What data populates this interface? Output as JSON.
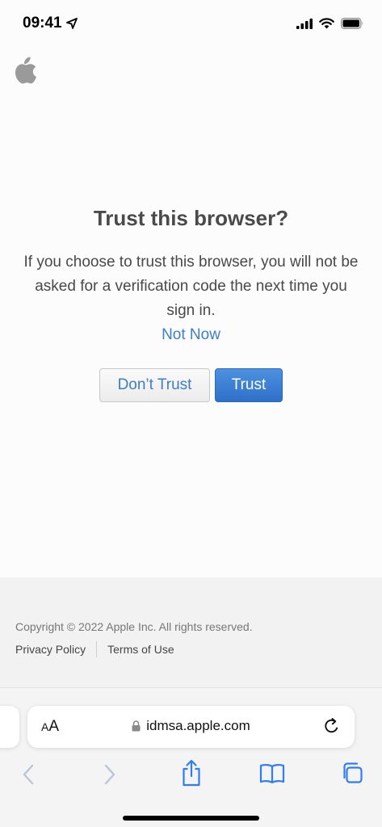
{
  "status_bar": {
    "time": "09:41",
    "icons": [
      "location-arrow-icon",
      "cellular-signal-icon",
      "wifi-icon",
      "battery-icon"
    ]
  },
  "main": {
    "title": "Trust this browser?",
    "description": "If you choose to trust this browser, you will not be asked for a verification code the next time you sign in.",
    "not_now_label": "Not Now",
    "dont_trust_label": "Don’t Trust",
    "trust_label": "Trust"
  },
  "footer": {
    "copyright": "Copyright © 2022 Apple Inc. All rights reserved.",
    "privacy_label": "Privacy Policy",
    "terms_label": "Terms of Use"
  },
  "browser": {
    "aa_small": "A",
    "aa_large": "A",
    "url": "idmsa.apple.com",
    "toolbar_icons": [
      "back-icon",
      "forward-icon",
      "share-icon",
      "bookmarks-icon",
      "tabs-icon"
    ]
  },
  "colors": {
    "link": "#3e7dc6",
    "primary_button": "#3a7bd5",
    "toolbar_active": "#2f7cf6",
    "toolbar_disabled": "#b8c6d8"
  }
}
